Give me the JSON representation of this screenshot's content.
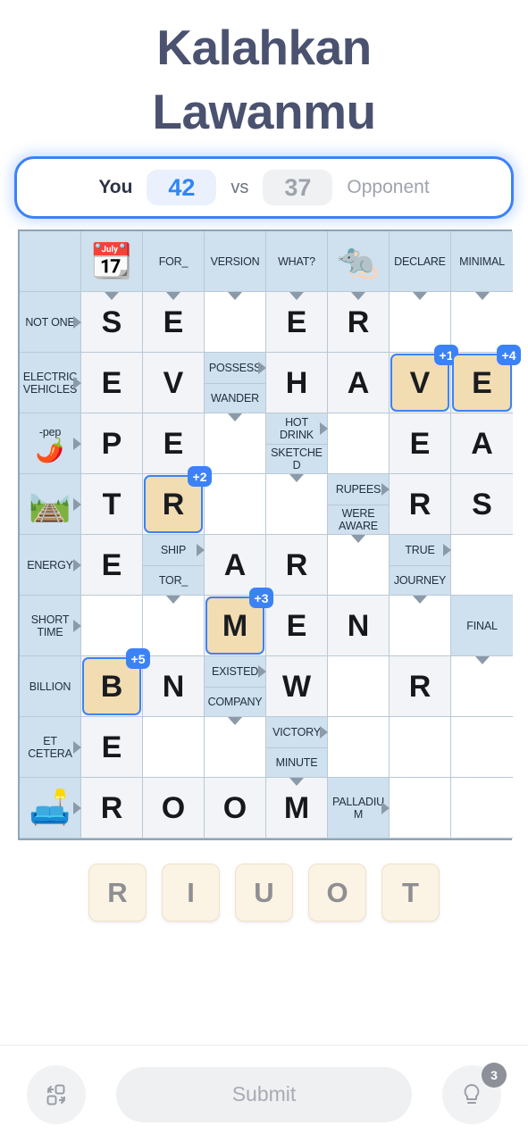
{
  "header": {
    "title_line1": "Kalahkan",
    "title_line2": "Lawanmu"
  },
  "score": {
    "you_label": "You",
    "you_score": "42",
    "vs_label": "vs",
    "opponent_score": "37",
    "opponent_label": "Opponent",
    "you_color": "#2f86f6",
    "opponent_color": "#9ea3ad",
    "border_color": "#3b82f6"
  },
  "grid": {
    "columns": 8,
    "rows": 10,
    "cells": [
      {
        "r": 0,
        "c": 0,
        "type": "clue"
      },
      {
        "r": 0,
        "c": 1,
        "type": "clue",
        "emoji": "📆",
        "icon": "calendar-sep-icon"
      },
      {
        "r": 0,
        "c": 2,
        "type": "clue",
        "text": "FOR_"
      },
      {
        "r": 0,
        "c": 3,
        "type": "clue",
        "text": "VERSION"
      },
      {
        "r": 0,
        "c": 4,
        "type": "clue",
        "text": "WHAT?"
      },
      {
        "r": 0,
        "c": 5,
        "type": "clue",
        "emoji": "🐀",
        "icon": "rat-icon"
      },
      {
        "r": 0,
        "c": 6,
        "type": "clue",
        "text": "DECLARE"
      },
      {
        "r": 0,
        "c": 7,
        "type": "clue",
        "text": "MINIMAL"
      },
      {
        "r": 1,
        "c": 0,
        "type": "clue",
        "text": "NOT ONE",
        "arrow": "right"
      },
      {
        "r": 1,
        "c": 1,
        "type": "letter",
        "letter": "S",
        "arrow": "down"
      },
      {
        "r": 1,
        "c": 2,
        "type": "letter",
        "letter": "E",
        "arrow": "down"
      },
      {
        "r": 1,
        "c": 3,
        "type": "empty",
        "arrow": "down"
      },
      {
        "r": 1,
        "c": 4,
        "type": "letter",
        "letter": "E",
        "arrow": "down"
      },
      {
        "r": 1,
        "c": 5,
        "type": "letter",
        "letter": "R",
        "arrow": "down"
      },
      {
        "r": 1,
        "c": 6,
        "type": "empty",
        "arrow": "down"
      },
      {
        "r": 1,
        "c": 7,
        "type": "empty",
        "arrow": "down"
      },
      {
        "r": 2,
        "c": 0,
        "type": "clue",
        "text": "ELECTRIC VEHICLES",
        "arrow": "right"
      },
      {
        "r": 2,
        "c": 1,
        "type": "letter",
        "letter": "E"
      },
      {
        "r": 2,
        "c": 2,
        "type": "letter",
        "letter": "V"
      },
      {
        "r": 2,
        "c": 3,
        "type": "clue2",
        "text_top": "POSSESS",
        "text_bottom": "WANDER",
        "arrow_top": "right"
      },
      {
        "r": 2,
        "c": 4,
        "type": "letter",
        "letter": "H"
      },
      {
        "r": 2,
        "c": 5,
        "type": "letter",
        "letter": "A"
      },
      {
        "r": 2,
        "c": 6,
        "type": "placed",
        "letter": "V",
        "badge": "+1"
      },
      {
        "r": 2,
        "c": 7,
        "type": "placed",
        "letter": "E",
        "badge": "+4"
      },
      {
        "r": 3,
        "c": 0,
        "type": "clue",
        "emoji": "🌶️",
        "icon": "chili-pepper-icon",
        "text": "-pep",
        "arrow": "right"
      },
      {
        "r": 3,
        "c": 1,
        "type": "letter",
        "letter": "P"
      },
      {
        "r": 3,
        "c": 2,
        "type": "letter",
        "letter": "E"
      },
      {
        "r": 3,
        "c": 3,
        "type": "empty",
        "arrow": "down"
      },
      {
        "r": 3,
        "c": 4,
        "type": "clue2",
        "text_top": "HOT DRINK",
        "text_bottom": "SKETCHED",
        "arrow_top": "right"
      },
      {
        "r": 3,
        "c": 5,
        "type": "empty"
      },
      {
        "r": 3,
        "c": 6,
        "type": "letter",
        "letter": "E"
      },
      {
        "r": 3,
        "c": 7,
        "type": "letter",
        "letter": "A"
      },
      {
        "r": 4,
        "c": 0,
        "type": "clue",
        "emoji": "🛤️",
        "icon": "path-icon",
        "arrow": "right"
      },
      {
        "r": 4,
        "c": 1,
        "type": "letter",
        "letter": "T"
      },
      {
        "r": 4,
        "c": 2,
        "type": "placed",
        "letter": "R",
        "badge": "+2"
      },
      {
        "r": 4,
        "c": 3,
        "type": "empty"
      },
      {
        "r": 4,
        "c": 4,
        "type": "empty",
        "arrow": "down"
      },
      {
        "r": 4,
        "c": 5,
        "type": "clue2",
        "text_top": "RUPEES",
        "text_bottom": "WERE AWARE",
        "arrow_top": "right"
      },
      {
        "r": 4,
        "c": 6,
        "type": "letter",
        "letter": "R"
      },
      {
        "r": 4,
        "c": 7,
        "type": "letter",
        "letter": "S"
      },
      {
        "r": 5,
        "c": 0,
        "type": "clue",
        "text": "ENERGY",
        "arrow": "right"
      },
      {
        "r": 5,
        "c": 1,
        "type": "letter",
        "letter": "E"
      },
      {
        "r": 5,
        "c": 2,
        "type": "clue2",
        "text_top": "SHIP",
        "text_bottom": "TOR_",
        "arrow_top": "right"
      },
      {
        "r": 5,
        "c": 3,
        "type": "letter",
        "letter": "A"
      },
      {
        "r": 5,
        "c": 4,
        "type": "letter",
        "letter": "R"
      },
      {
        "r": 5,
        "c": 5,
        "type": "empty",
        "arrow": "down"
      },
      {
        "r": 5,
        "c": 6,
        "type": "clue2",
        "text_top": "TRUE",
        "text_bottom": "JOURNEY",
        "arrow_top": "right"
      },
      {
        "r": 5,
        "c": 7,
        "type": "empty"
      },
      {
        "r": 6,
        "c": 0,
        "type": "clue",
        "text": "SHORT TIME",
        "arrow": "right"
      },
      {
        "r": 6,
        "c": 1,
        "type": "empty"
      },
      {
        "r": 6,
        "c": 2,
        "type": "empty",
        "arrow": "down"
      },
      {
        "r": 6,
        "c": 3,
        "type": "placed",
        "letter": "M",
        "badge": "+3"
      },
      {
        "r": 6,
        "c": 4,
        "type": "letter",
        "letter": "E"
      },
      {
        "r": 6,
        "c": 5,
        "type": "letter",
        "letter": "N"
      },
      {
        "r": 6,
        "c": 6,
        "type": "empty",
        "arrow": "down"
      },
      {
        "r": 6,
        "c": 7,
        "type": "clue",
        "text": "FINAL"
      },
      {
        "r": 7,
        "c": 0,
        "type": "clue",
        "text": "BILLION"
      },
      {
        "r": 7,
        "c": 1,
        "type": "placed",
        "letter": "B",
        "badge": "+5"
      },
      {
        "r": 7,
        "c": 2,
        "type": "letter",
        "letter": "N"
      },
      {
        "r": 7,
        "c": 3,
        "type": "clue2",
        "text_top": "EXISTED",
        "text_bottom": "COMPANY",
        "arrow_top": "right"
      },
      {
        "r": 7,
        "c": 4,
        "type": "letter",
        "letter": "W"
      },
      {
        "r": 7,
        "c": 5,
        "type": "empty"
      },
      {
        "r": 7,
        "c": 6,
        "type": "letter",
        "letter": "R"
      },
      {
        "r": 7,
        "c": 7,
        "type": "empty",
        "arrow": "down"
      },
      {
        "r": 8,
        "c": 0,
        "type": "clue",
        "text": "ET CETERA",
        "arrow": "right"
      },
      {
        "r": 8,
        "c": 1,
        "type": "letter",
        "letter": "E"
      },
      {
        "r": 8,
        "c": 2,
        "type": "empty"
      },
      {
        "r": 8,
        "c": 3,
        "type": "empty",
        "arrow": "down"
      },
      {
        "r": 8,
        "c": 4,
        "type": "clue2",
        "text_top": "VICTORY",
        "text_bottom": "MINUTE",
        "arrow_top": "right"
      },
      {
        "r": 8,
        "c": 5,
        "type": "empty"
      },
      {
        "r": 8,
        "c": 6,
        "type": "empty"
      },
      {
        "r": 8,
        "c": 7,
        "type": "empty"
      },
      {
        "r": 9,
        "c": 0,
        "type": "clue",
        "emoji": "🛋️",
        "icon": "sofa-icon",
        "arrow": "right"
      },
      {
        "r": 9,
        "c": 1,
        "type": "letter",
        "letter": "R"
      },
      {
        "r": 9,
        "c": 2,
        "type": "letter",
        "letter": "O"
      },
      {
        "r": 9,
        "c": 3,
        "type": "letter",
        "letter": "O"
      },
      {
        "r": 9,
        "c": 4,
        "type": "letter",
        "letter": "M",
        "arrow": "down"
      },
      {
        "r": 9,
        "c": 5,
        "type": "clue",
        "text": "PALLADIUM",
        "arrow": "right"
      },
      {
        "r": 9,
        "c": 6,
        "type": "empty"
      },
      {
        "r": 9,
        "c": 7,
        "type": "empty"
      }
    ]
  },
  "tray": {
    "tiles": [
      "R",
      "I",
      "U",
      "O",
      "T"
    ]
  },
  "bottom": {
    "shuffle_icon": "shuffle-icon",
    "submit_label": "Submit",
    "hint_icon": "lightbulb-icon",
    "hint_count": "3"
  }
}
